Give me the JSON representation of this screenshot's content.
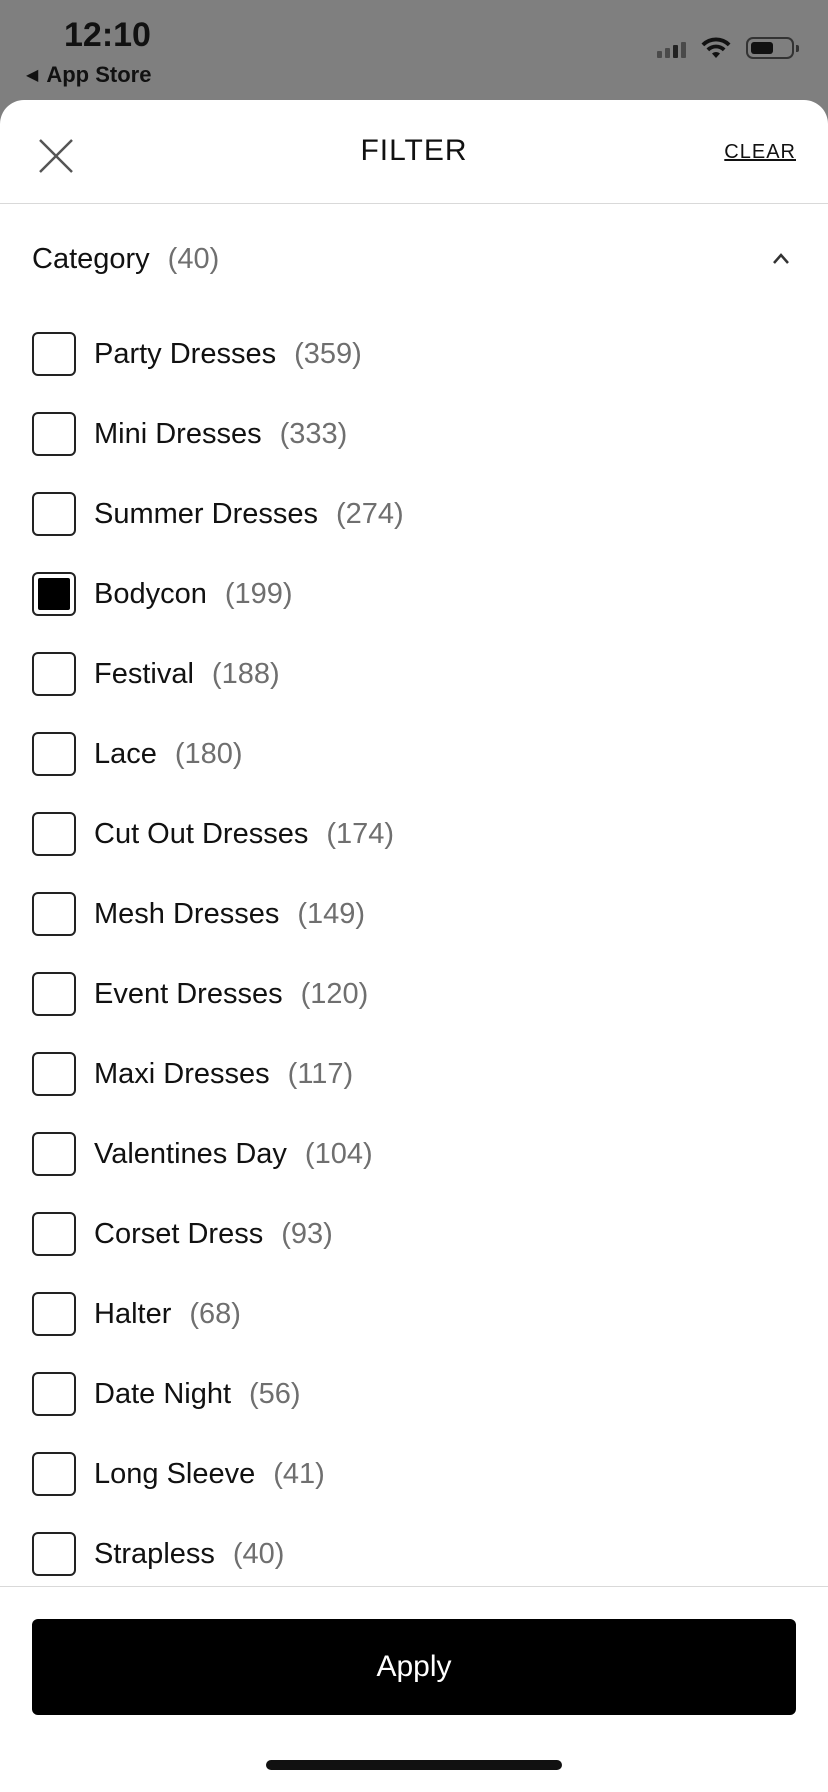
{
  "status_bar": {
    "time": "12:10",
    "back_label": "App Store",
    "icons": [
      "signal-icon",
      "wifi-icon",
      "battery-icon"
    ]
  },
  "header": {
    "title": "FILTER",
    "clear_label": "CLEAR",
    "close_icon": "close-icon"
  },
  "section": {
    "title": "Category",
    "count": "(40)",
    "expanded": true
  },
  "options": [
    {
      "label": "Party Dresses",
      "count": "(359)",
      "checked": false
    },
    {
      "label": "Mini Dresses",
      "count": "(333)",
      "checked": false
    },
    {
      "label": "Summer Dresses",
      "count": "(274)",
      "checked": false
    },
    {
      "label": "Bodycon",
      "count": "(199)",
      "checked": true
    },
    {
      "label": "Festival",
      "count": "(188)",
      "checked": false
    },
    {
      "label": "Lace",
      "count": "(180)",
      "checked": false
    },
    {
      "label": "Cut Out Dresses",
      "count": "(174)",
      "checked": false
    },
    {
      "label": "Mesh Dresses",
      "count": "(149)",
      "checked": false
    },
    {
      "label": "Event Dresses",
      "count": "(120)",
      "checked": false
    },
    {
      "label": "Maxi Dresses",
      "count": "(117)",
      "checked": false
    },
    {
      "label": "Valentines Day",
      "count": "(104)",
      "checked": false
    },
    {
      "label": "Corset Dress",
      "count": "(93)",
      "checked": false
    },
    {
      "label": "Halter",
      "count": "(68)",
      "checked": false
    },
    {
      "label": "Date Night",
      "count": "(56)",
      "checked": false
    },
    {
      "label": "Long Sleeve",
      "count": "(41)",
      "checked": false
    },
    {
      "label": "Strapless",
      "count": "(40)",
      "checked": false
    }
  ],
  "footer": {
    "apply_label": "Apply"
  }
}
